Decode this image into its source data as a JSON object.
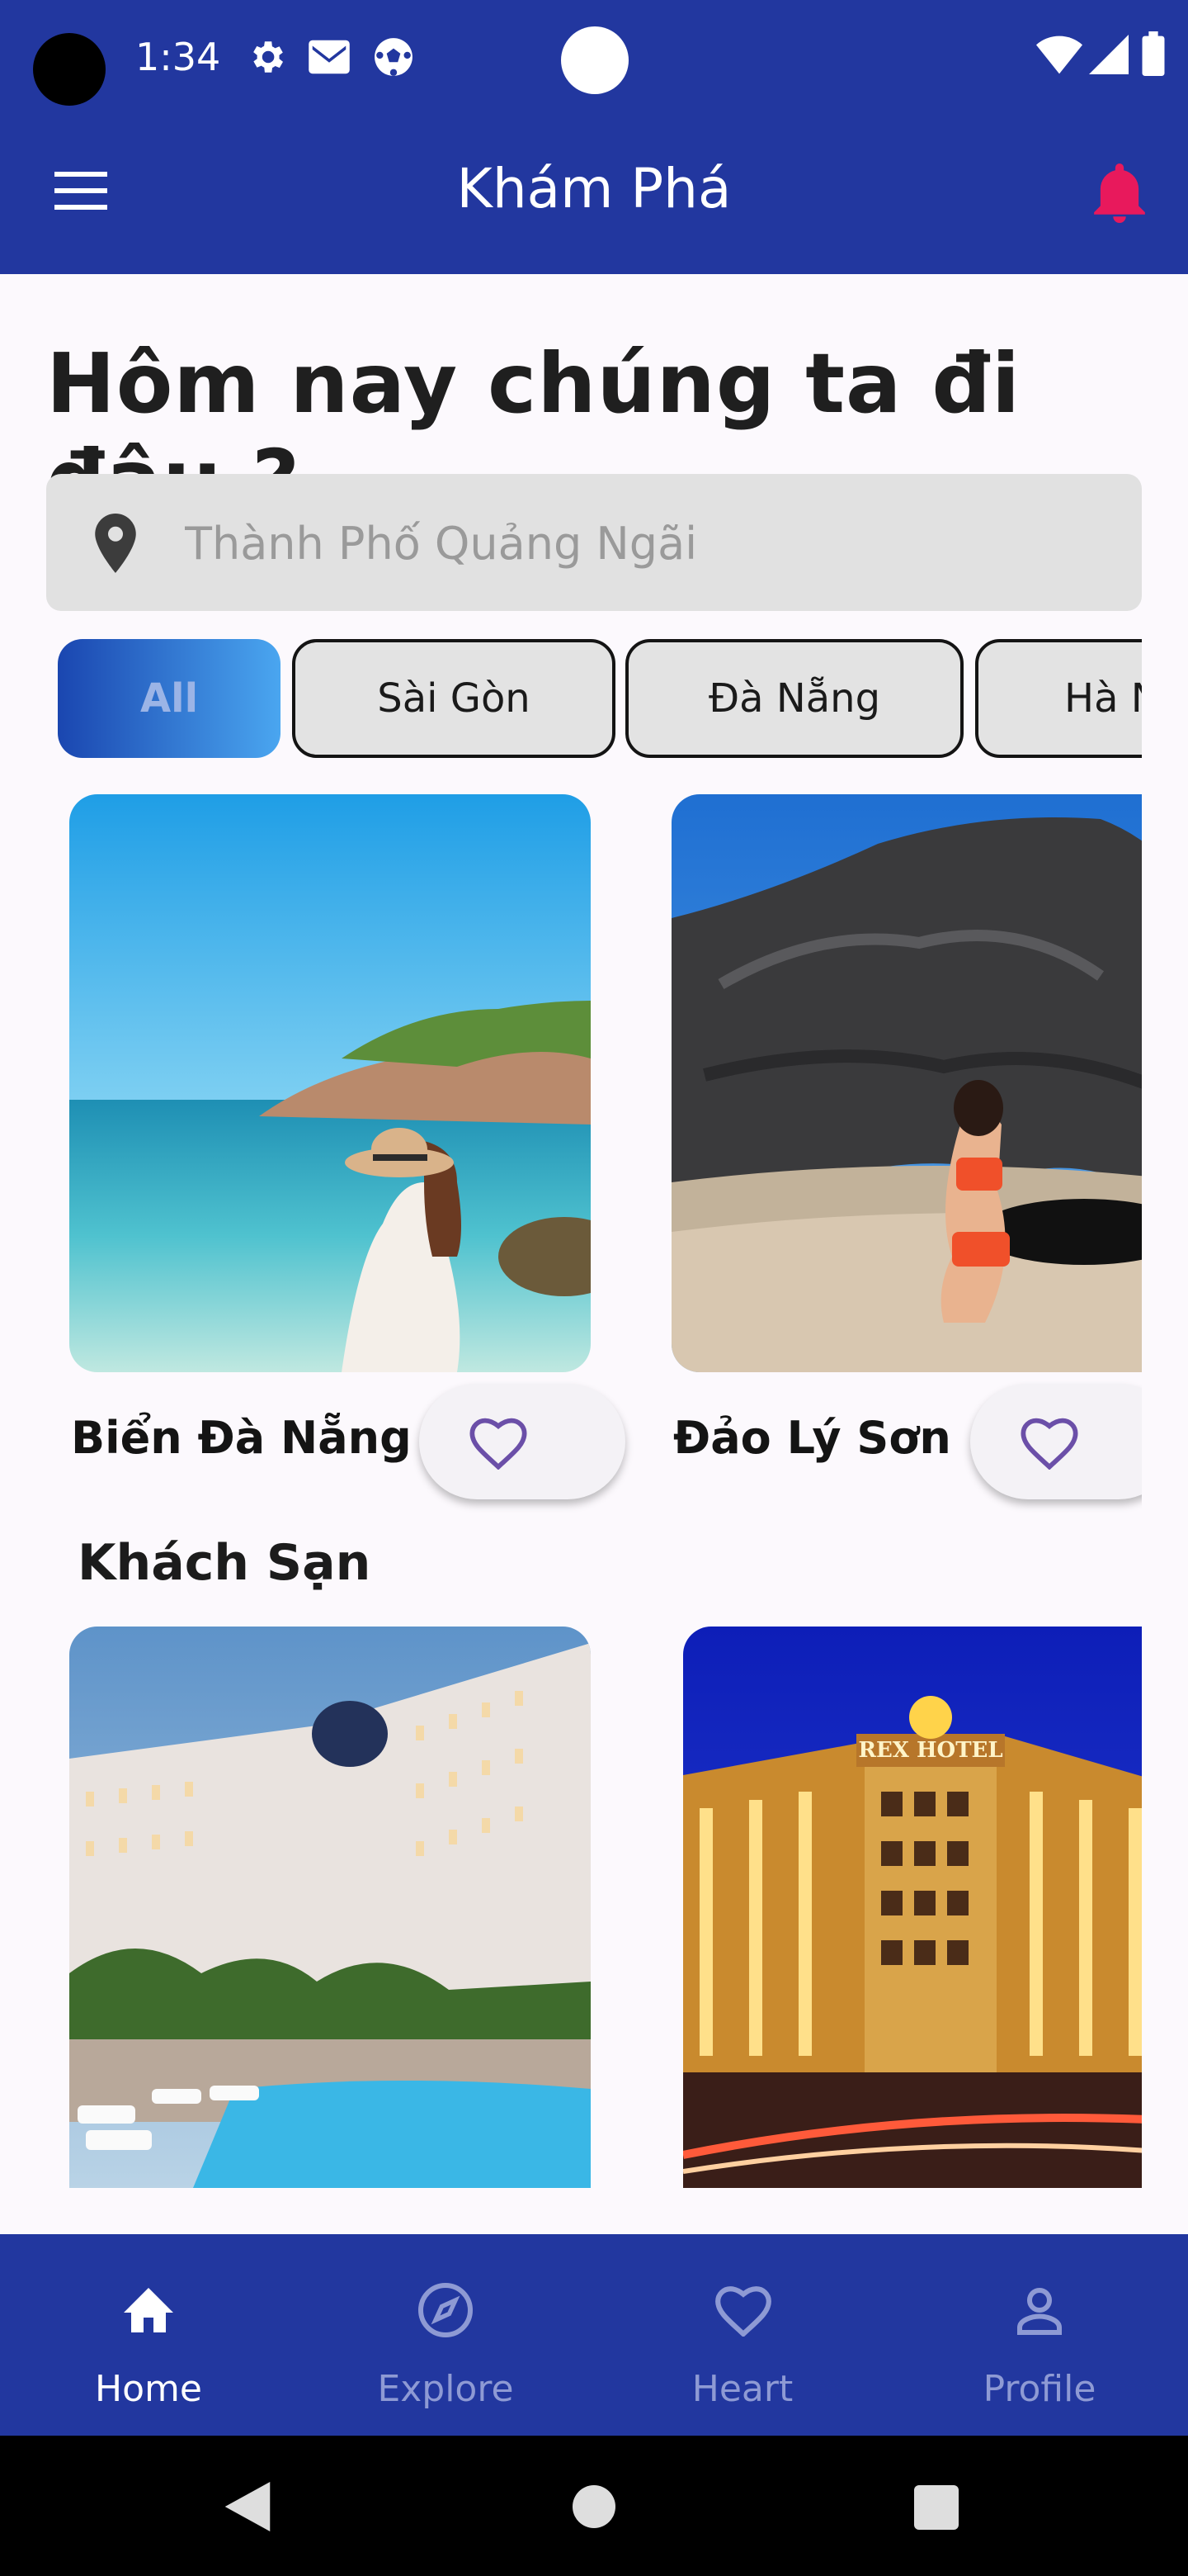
{
  "status_bar": {
    "time": "1:34"
  },
  "app_bar": {
    "title": "Khám Phá"
  },
  "heading": "Hôm nay chúng ta đi đâu ?",
  "search": {
    "placeholder": "Thành Phố Quảng Ngãi"
  },
  "chips": [
    {
      "label": "All",
      "active": true
    },
    {
      "label": "Sài Gòn",
      "active": false
    },
    {
      "label": "Đà Nẵng",
      "active": false
    },
    {
      "label": "Hà Nội",
      "active": false
    }
  ],
  "places": [
    {
      "name": "Biển Đà Nẵng",
      "image": "beach-photo"
    },
    {
      "name": "Đảo Lý Sơn",
      "image": "island-rock-photo"
    }
  ],
  "hotels_section": {
    "title": "Khách Sạn",
    "items": [
      {
        "image": "resort-hotel-photo"
      },
      {
        "image": "rex-hotel-night-photo",
        "sign": "REX HOTEL"
      }
    ]
  },
  "bottom_nav": [
    {
      "label": "Home",
      "icon": "home-icon",
      "active": true
    },
    {
      "label": "Explore",
      "icon": "compass-icon",
      "active": false
    },
    {
      "label": "Heart",
      "icon": "heart-icon",
      "active": false
    },
    {
      "label": "Profile",
      "icon": "person-icon",
      "active": false
    }
  ],
  "colors": {
    "primary": "#22379f",
    "bell": "#e8195c",
    "heart_outline": "#6b4fa8"
  }
}
